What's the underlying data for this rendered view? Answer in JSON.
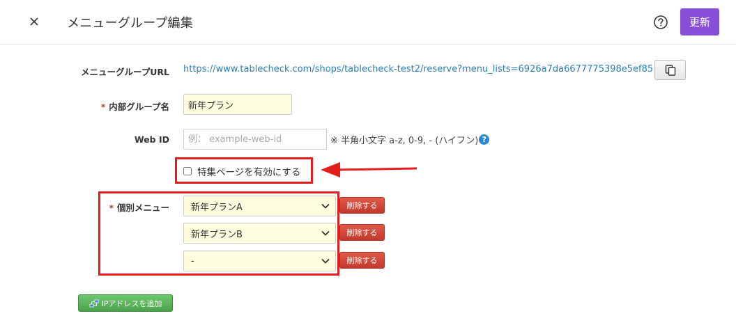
{
  "header": {
    "title": "メニューグループ編集",
    "update_label": "更新",
    "close_icon": "close-icon",
    "help_icon": "question-circle-icon"
  },
  "form": {
    "url_label": "メニューグループURL",
    "url_value": "https://www.tablecheck.com/shops/tablecheck-test2/reserve?menu_lists=6926a7da6677775398e5ef85",
    "internal_name_label": "内部グループ名",
    "internal_name_value": "新年プラン",
    "web_id_label": "Web ID",
    "web_id_placeholder": "例： example-web-id",
    "web_id_hint": "※ 半角小文字 a-z, 0-9, - (ハイフン)",
    "feature_checkbox_label": "特集ページを有効にする",
    "feature_checked": false,
    "menu_label": "個別メニュー",
    "required_mark": "*",
    "menus": [
      {
        "value": "新年プランA",
        "delete_label": "削除する"
      },
      {
        "value": "新年プランB",
        "delete_label": "削除する"
      },
      {
        "value": "-",
        "delete_label": "削除する"
      }
    ],
    "add_ip_label": "IPアドレスを追加"
  },
  "colors": {
    "accent": "#8a4fd8",
    "link": "#2a7fb8",
    "highlight": "#e51c1c",
    "input_bg": "#fffde0"
  }
}
